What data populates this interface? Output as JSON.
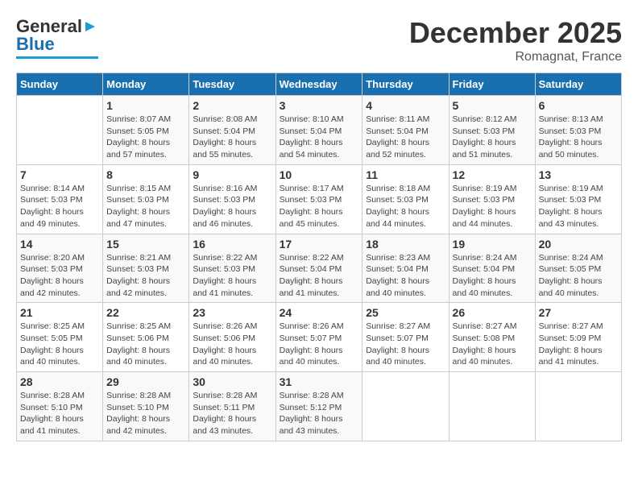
{
  "logo": {
    "line1": "General",
    "line2": "Blue"
  },
  "title": "December 2025",
  "subtitle": "Romagnat, France",
  "days_header": [
    "Sunday",
    "Monday",
    "Tuesday",
    "Wednesday",
    "Thursday",
    "Friday",
    "Saturday"
  ],
  "weeks": [
    [
      {
        "day": "",
        "info": ""
      },
      {
        "day": "1",
        "info": "Sunrise: 8:07 AM\nSunset: 5:05 PM\nDaylight: 8 hours\nand 57 minutes."
      },
      {
        "day": "2",
        "info": "Sunrise: 8:08 AM\nSunset: 5:04 PM\nDaylight: 8 hours\nand 55 minutes."
      },
      {
        "day": "3",
        "info": "Sunrise: 8:10 AM\nSunset: 5:04 PM\nDaylight: 8 hours\nand 54 minutes."
      },
      {
        "day": "4",
        "info": "Sunrise: 8:11 AM\nSunset: 5:04 PM\nDaylight: 8 hours\nand 52 minutes."
      },
      {
        "day": "5",
        "info": "Sunrise: 8:12 AM\nSunset: 5:03 PM\nDaylight: 8 hours\nand 51 minutes."
      },
      {
        "day": "6",
        "info": "Sunrise: 8:13 AM\nSunset: 5:03 PM\nDaylight: 8 hours\nand 50 minutes."
      }
    ],
    [
      {
        "day": "7",
        "info": "Sunrise: 8:14 AM\nSunset: 5:03 PM\nDaylight: 8 hours\nand 49 minutes."
      },
      {
        "day": "8",
        "info": "Sunrise: 8:15 AM\nSunset: 5:03 PM\nDaylight: 8 hours\nand 47 minutes."
      },
      {
        "day": "9",
        "info": "Sunrise: 8:16 AM\nSunset: 5:03 PM\nDaylight: 8 hours\nand 46 minutes."
      },
      {
        "day": "10",
        "info": "Sunrise: 8:17 AM\nSunset: 5:03 PM\nDaylight: 8 hours\nand 45 minutes."
      },
      {
        "day": "11",
        "info": "Sunrise: 8:18 AM\nSunset: 5:03 PM\nDaylight: 8 hours\nand 44 minutes."
      },
      {
        "day": "12",
        "info": "Sunrise: 8:19 AM\nSunset: 5:03 PM\nDaylight: 8 hours\nand 44 minutes."
      },
      {
        "day": "13",
        "info": "Sunrise: 8:19 AM\nSunset: 5:03 PM\nDaylight: 8 hours\nand 43 minutes."
      }
    ],
    [
      {
        "day": "14",
        "info": "Sunrise: 8:20 AM\nSunset: 5:03 PM\nDaylight: 8 hours\nand 42 minutes."
      },
      {
        "day": "15",
        "info": "Sunrise: 8:21 AM\nSunset: 5:03 PM\nDaylight: 8 hours\nand 42 minutes."
      },
      {
        "day": "16",
        "info": "Sunrise: 8:22 AM\nSunset: 5:03 PM\nDaylight: 8 hours\nand 41 minutes."
      },
      {
        "day": "17",
        "info": "Sunrise: 8:22 AM\nSunset: 5:04 PM\nDaylight: 8 hours\nand 41 minutes."
      },
      {
        "day": "18",
        "info": "Sunrise: 8:23 AM\nSunset: 5:04 PM\nDaylight: 8 hours\nand 40 minutes."
      },
      {
        "day": "19",
        "info": "Sunrise: 8:24 AM\nSunset: 5:04 PM\nDaylight: 8 hours\nand 40 minutes."
      },
      {
        "day": "20",
        "info": "Sunrise: 8:24 AM\nSunset: 5:05 PM\nDaylight: 8 hours\nand 40 minutes."
      }
    ],
    [
      {
        "day": "21",
        "info": "Sunrise: 8:25 AM\nSunset: 5:05 PM\nDaylight: 8 hours\nand 40 minutes."
      },
      {
        "day": "22",
        "info": "Sunrise: 8:25 AM\nSunset: 5:06 PM\nDaylight: 8 hours\nand 40 minutes."
      },
      {
        "day": "23",
        "info": "Sunrise: 8:26 AM\nSunset: 5:06 PM\nDaylight: 8 hours\nand 40 minutes."
      },
      {
        "day": "24",
        "info": "Sunrise: 8:26 AM\nSunset: 5:07 PM\nDaylight: 8 hours\nand 40 minutes."
      },
      {
        "day": "25",
        "info": "Sunrise: 8:27 AM\nSunset: 5:07 PM\nDaylight: 8 hours\nand 40 minutes."
      },
      {
        "day": "26",
        "info": "Sunrise: 8:27 AM\nSunset: 5:08 PM\nDaylight: 8 hours\nand 40 minutes."
      },
      {
        "day": "27",
        "info": "Sunrise: 8:27 AM\nSunset: 5:09 PM\nDaylight: 8 hours\nand 41 minutes."
      }
    ],
    [
      {
        "day": "28",
        "info": "Sunrise: 8:28 AM\nSunset: 5:10 PM\nDaylight: 8 hours\nand 41 minutes."
      },
      {
        "day": "29",
        "info": "Sunrise: 8:28 AM\nSunset: 5:10 PM\nDaylight: 8 hours\nand 42 minutes."
      },
      {
        "day": "30",
        "info": "Sunrise: 8:28 AM\nSunset: 5:11 PM\nDaylight: 8 hours\nand 43 minutes."
      },
      {
        "day": "31",
        "info": "Sunrise: 8:28 AM\nSunset: 5:12 PM\nDaylight: 8 hours\nand 43 minutes."
      },
      {
        "day": "",
        "info": ""
      },
      {
        "day": "",
        "info": ""
      },
      {
        "day": "",
        "info": ""
      }
    ]
  ]
}
